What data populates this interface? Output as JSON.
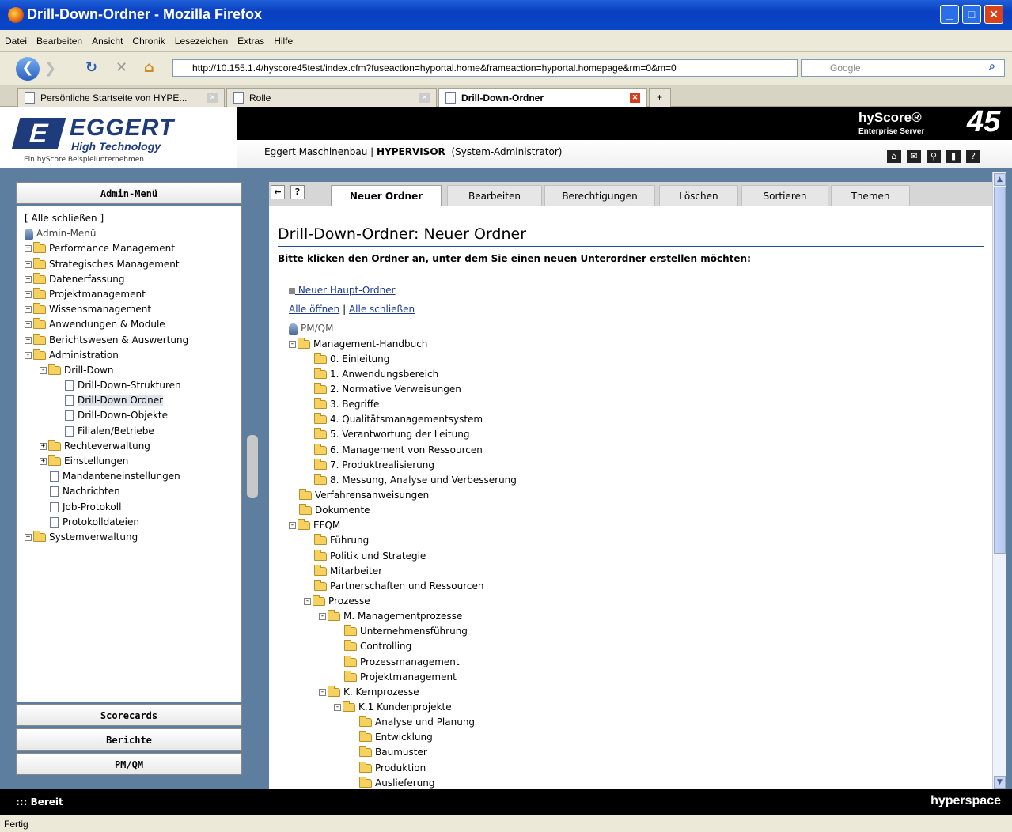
{
  "window": {
    "title": "Drill-Down-Ordner - Mozilla Firefox"
  },
  "menu": [
    "Datei",
    "Bearbeiten",
    "Ansicht",
    "Chronik",
    "Lesezeichen",
    "Extras",
    "Hilfe"
  ],
  "nav": {
    "url": "http://10.155.1.4/hyscore45test/index.cfm?fuseaction=hyportal.home&frameaction=hyportal.homepage&rm=0&m=0",
    "search_placeholder": "Google"
  },
  "browser_tabs": [
    {
      "label": "Persönliche Startseite von HYPE..."
    },
    {
      "label": "Rolle"
    },
    {
      "label": "Drill-Down-Ordner"
    }
  ],
  "header": {
    "logo_name": "EGGERT",
    "logo_letter": "E",
    "logo_sub": "High Technology",
    "logo_tag": "Ein hyScore Beispielunternehmen",
    "org": "Eggert Maschinenbau | ",
    "user": "HYPERVISOR",
    "role": "(System-Administrator)",
    "product": "hyScore®",
    "product_sub": "Enterprise Server",
    "version": "45"
  },
  "sidebar": {
    "head": "Admin-Menü",
    "close_all": "[ Alle schließen ]",
    "root": "Admin-Menü",
    "items": [
      {
        "label": "Performance Management",
        "indent": 0,
        "type": "folder",
        "pm": "+"
      },
      {
        "label": "Strategisches Management",
        "indent": 0,
        "type": "folder",
        "pm": "+"
      },
      {
        "label": "Datenerfassung",
        "indent": 0,
        "type": "folder",
        "pm": "+"
      },
      {
        "label": "Projektmanagement",
        "indent": 0,
        "type": "folder",
        "pm": "+"
      },
      {
        "label": "Wissensmanagement",
        "indent": 0,
        "type": "folder",
        "pm": "+"
      },
      {
        "label": "Anwendungen & Module",
        "indent": 0,
        "type": "folder",
        "pm": "+"
      },
      {
        "label": "Berichtswesen & Auswertung",
        "indent": 0,
        "type": "folder",
        "pm": "+"
      },
      {
        "label": "Administration",
        "indent": 0,
        "type": "folder",
        "pm": "-"
      },
      {
        "label": "Drill-Down",
        "indent": 1,
        "type": "folder",
        "pm": "-"
      },
      {
        "label": "Drill-Down-Strukturen",
        "indent": 2,
        "type": "doc",
        "pm": ""
      },
      {
        "label": "Drill-Down Ordner",
        "indent": 2,
        "type": "doc",
        "pm": "",
        "selected": true
      },
      {
        "label": "Drill-Down-Objekte",
        "indent": 2,
        "type": "doc",
        "pm": ""
      },
      {
        "label": "Filialen/Betriebe",
        "indent": 2,
        "type": "doc",
        "pm": ""
      },
      {
        "label": "Rechteverwaltung",
        "indent": 1,
        "type": "folder",
        "pm": "+"
      },
      {
        "label": "Einstellungen",
        "indent": 1,
        "type": "folder",
        "pm": "+"
      },
      {
        "label": "Mandanteneinstellungen",
        "indent": 1,
        "type": "doc",
        "pm": ""
      },
      {
        "label": "Nachrichten",
        "indent": 1,
        "type": "doc",
        "pm": ""
      },
      {
        "label": "Job-Protokoll",
        "indent": 1,
        "type": "doc",
        "pm": ""
      },
      {
        "label": "Protokolldateien",
        "indent": 1,
        "type": "doc",
        "pm": ""
      },
      {
        "label": "Systemverwaltung",
        "indent": 0,
        "type": "folder",
        "pm": "+"
      }
    ],
    "buttons": [
      "Scorecards",
      "Berichte",
      "PM/QM"
    ]
  },
  "content_tabs": [
    "Neuer Ordner",
    "Bearbeiten",
    "Berechtigungen",
    "Löschen",
    "Sortieren",
    "Themen"
  ],
  "content": {
    "title": "Drill-Down-Ordner: Neuer Ordner",
    "instruction": "Bitte klicken den Ordner an, unter dem Sie einen neuen Unterordner erstellen möchten:",
    "new_main": " Neuer Haupt-Ordner",
    "open_all": "Alle öffnen",
    "sep": " | ",
    "close_all": "Alle schließen",
    "root": "PM/QM",
    "tree": [
      {
        "label": "Management-Handbuch",
        "indent": 0,
        "pm": "-"
      },
      {
        "label": "0. Einleitung",
        "indent": 1,
        "pm": ""
      },
      {
        "label": "1. Anwendungsbereich",
        "indent": 1,
        "pm": ""
      },
      {
        "label": "2. Normative Verweisungen",
        "indent": 1,
        "pm": ""
      },
      {
        "label": "3. Begriffe",
        "indent": 1,
        "pm": ""
      },
      {
        "label": "4. Qualitätsmanagementsystem",
        "indent": 1,
        "pm": ""
      },
      {
        "label": "5. Verantwortung der Leitung",
        "indent": 1,
        "pm": ""
      },
      {
        "label": "6. Management von Ressourcen",
        "indent": 1,
        "pm": ""
      },
      {
        "label": "7. Produktrealisierung",
        "indent": 1,
        "pm": ""
      },
      {
        "label": "8. Messung, Analyse und Verbesserung",
        "indent": 1,
        "pm": ""
      },
      {
        "label": "Verfahrensanweisungen",
        "indent": 0,
        "pm": ""
      },
      {
        "label": "Dokumente",
        "indent": 0,
        "pm": ""
      },
      {
        "label": "EFQM",
        "indent": 0,
        "pm": "-"
      },
      {
        "label": "Führung",
        "indent": 1,
        "pm": ""
      },
      {
        "label": "Politik und Strategie",
        "indent": 1,
        "pm": ""
      },
      {
        "label": "Mitarbeiter",
        "indent": 1,
        "pm": ""
      },
      {
        "label": "Partnerschaften und Ressourcen",
        "indent": 1,
        "pm": ""
      },
      {
        "label": "Prozesse",
        "indent": 1,
        "pm": "-"
      },
      {
        "label": "M. Managementprozesse",
        "indent": 2,
        "pm": "-"
      },
      {
        "label": "Unternehmensführung",
        "indent": 3,
        "pm": ""
      },
      {
        "label": "Controlling",
        "indent": 3,
        "pm": ""
      },
      {
        "label": "Prozessmanagement",
        "indent": 3,
        "pm": ""
      },
      {
        "label": "Projektmanagement",
        "indent": 3,
        "pm": ""
      },
      {
        "label": "K. Kernprozesse",
        "indent": 2,
        "pm": "-"
      },
      {
        "label": "K.1 Kundenprojekte",
        "indent": 3,
        "pm": "-"
      },
      {
        "label": "Analyse und Planung",
        "indent": 4,
        "pm": ""
      },
      {
        "label": "Entwicklung",
        "indent": 4,
        "pm": ""
      },
      {
        "label": "Baumuster",
        "indent": 4,
        "pm": ""
      },
      {
        "label": "Produktion",
        "indent": 4,
        "pm": ""
      },
      {
        "label": "Auslieferung",
        "indent": 4,
        "pm": ""
      }
    ]
  },
  "status": {
    "app": "::: Bereit",
    "brand": "hyperspace",
    "browser": "Fertig"
  }
}
